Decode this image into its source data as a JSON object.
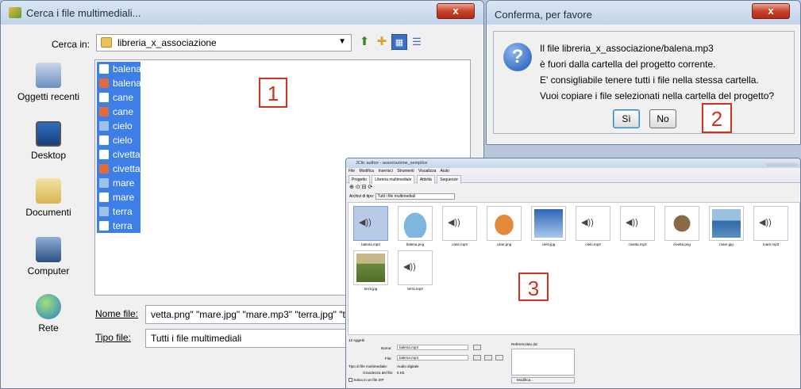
{
  "open_dialog": {
    "title": "Cerca i file multimediali...",
    "close_label": "x",
    "look_in_label": "Cerca in:",
    "look_in_value": "libreria_x_associazione",
    "toolbar": {
      "up_icon": "folder-up-icon",
      "new_icon": "new-folder-icon",
      "list_icon": "list-view-icon",
      "details_icon": "details-view-icon"
    },
    "places": [
      {
        "label": "Oggetti recenti",
        "icon": "recent-items-icon"
      },
      {
        "label": "Desktop",
        "icon": "desktop-icon"
      },
      {
        "label": "Documenti",
        "icon": "documents-icon"
      },
      {
        "label": "Computer",
        "icon": "computer-icon"
      },
      {
        "label": "Rete",
        "icon": "network-icon"
      }
    ],
    "files": [
      {
        "name": "balena",
        "type": "audio"
      },
      {
        "name": "balena",
        "type": "image"
      },
      {
        "name": "cane",
        "type": "audio"
      },
      {
        "name": "cane",
        "type": "image"
      },
      {
        "name": "cielo",
        "type": "photo"
      },
      {
        "name": "cielo",
        "type": "audio"
      },
      {
        "name": "civetta",
        "type": "audio"
      },
      {
        "name": "civetta",
        "type": "image"
      },
      {
        "name": "mare",
        "type": "photo"
      },
      {
        "name": "mare",
        "type": "audio"
      },
      {
        "name": "terra",
        "type": "photo"
      },
      {
        "name": "terra",
        "type": "audio"
      }
    ],
    "filename_label": "Nome file:",
    "filename_value": "vetta.png\" \"mare.jpg\" \"mare.mp3\" \"terra.jpg\" \"te",
    "filetype_label": "Tipo file:",
    "filetype_value": "Tutti i file multimediali",
    "marker": "1"
  },
  "confirm_dialog": {
    "title": "Conferma, per favore",
    "close_label": "x",
    "lines": [
      "Il file libreria_x_associazione/balena.mp3",
      "è fuori dalla cartella del progetto corrente.",
      "E' consigliabile tenere tutti i file nella stessa cartella.",
      "Vuoi copiare i file selezionati nella cartella del progetto?"
    ],
    "yes_label": "Sì",
    "no_label": "No",
    "marker": "2"
  },
  "jclic_window": {
    "title": "JClic author - associazione_semplice",
    "menu": [
      "File",
      "Modifica",
      "Inserisci",
      "Strumenti",
      "Visualizza",
      "Aiuto"
    ],
    "tabs": [
      "Progetto",
      "Libreria multimediale",
      "Attività",
      "Sequenze"
    ],
    "filter_label": "Archivi di tipo:",
    "filter_value": "Tutti i file multimediali",
    "media": [
      {
        "name": "balena.mp3",
        "kind": "audio",
        "selected": true
      },
      {
        "name": "balena.png",
        "kind": "image",
        "color": "#7fb6df"
      },
      {
        "name": "cane.mp3",
        "kind": "audio"
      },
      {
        "name": "cane.png",
        "kind": "image",
        "color": "#e08a3a"
      },
      {
        "name": "cielo.jpg",
        "kind": "image",
        "color": "#3b73c4"
      },
      {
        "name": "cielo.mp3",
        "kind": "audio"
      },
      {
        "name": "civetta.mp3",
        "kind": "audio"
      },
      {
        "name": "civetta.png",
        "kind": "image",
        "color": "#8a6a44"
      },
      {
        "name": "mare.jpg",
        "kind": "image",
        "color": "#4e86bd"
      },
      {
        "name": "mare.mp3",
        "kind": "audio"
      },
      {
        "name": "terra.jpg",
        "kind": "image",
        "color": "#6a8a3a"
      },
      {
        "name": "terra.mp3",
        "kind": "audio"
      }
    ],
    "count_text": "12 oggetti",
    "name_label": "Nome:",
    "name_value": "balena.mp3",
    "file_label": "File:",
    "file_value": "balena.mp3",
    "type_label": "Tipo di file multimediale:",
    "type_value": "Audio digitale",
    "size_label": "Grandezza del file:",
    "size_value": "5 Kb",
    "zip_label": "Salva in un file ZIP",
    "ref_label": "Referenziato da:",
    "modify_label": "Modifica...",
    "marker": "3"
  }
}
